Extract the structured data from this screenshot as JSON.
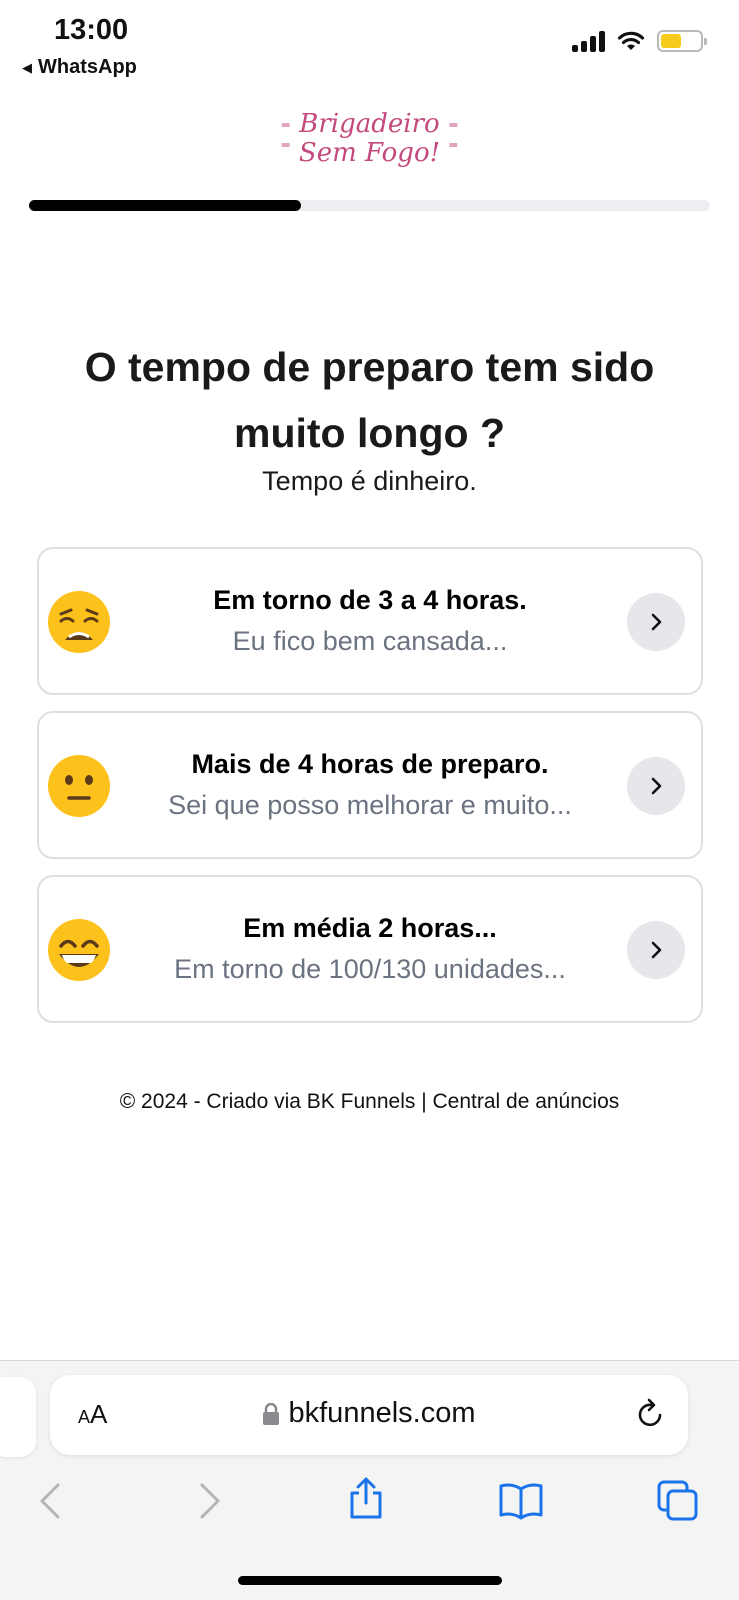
{
  "status": {
    "time": "13:00",
    "back_app": "WhatsApp",
    "battery_color": "#f6cb1c"
  },
  "logo": {
    "line1": "Brigadeiro",
    "line2": "Sem Fogo!",
    "color": "#c44a7e"
  },
  "progress": {
    "value": 0.4
  },
  "question": {
    "title": "O tempo de preparo tem sido muito longo ?",
    "subtitle": "Tempo é dinheiro."
  },
  "options": [
    {
      "emoji": "weary-face-icon",
      "title": "Em torno de 3 a 4 horas.",
      "desc": "Eu fico bem cansada..."
    },
    {
      "emoji": "neutral-face-icon",
      "title": "Mais de 4 horas de preparo.",
      "desc": "Sei que posso melhorar e muito..."
    },
    {
      "emoji": "grinning-face-icon",
      "title": "Em média 2 horas...",
      "desc": "Em torno de 100/130 unidades..."
    }
  ],
  "footer": "© 2024 - Criado via BK Funnels | Central de anúncios",
  "browser": {
    "text_size_label": "AA",
    "url": "bkfunnels.com",
    "accent": "#1a73e8"
  }
}
